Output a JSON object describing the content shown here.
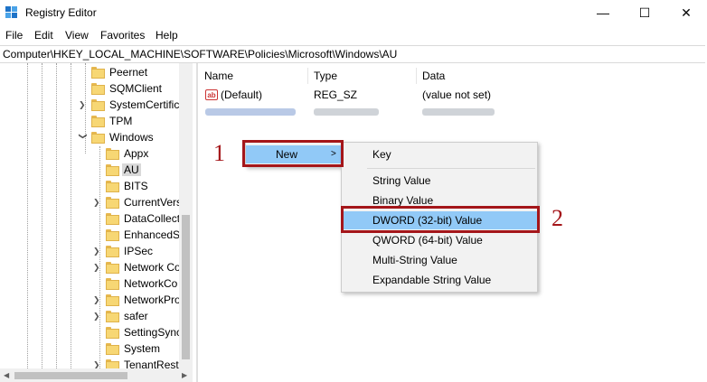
{
  "window": {
    "title": "Registry Editor",
    "icon": "registry-editor-icon",
    "controls": {
      "minimize": "—",
      "maximize": "☐",
      "close": "✕"
    }
  },
  "menu": [
    "File",
    "Edit",
    "View",
    "Favorites",
    "Help"
  ],
  "address": "Computer\\HKEY_LOCAL_MACHINE\\SOFTWARE\\Policies\\Microsoft\\Windows\\AU",
  "tree": {
    "items": [
      {
        "label": "Peernet",
        "level": 1,
        "expander": ""
      },
      {
        "label": "SQMClient",
        "level": 1,
        "expander": ""
      },
      {
        "label": "SystemCertific",
        "level": 1,
        "expander": ">"
      },
      {
        "label": "TPM",
        "level": 1,
        "expander": ""
      },
      {
        "label": "Windows",
        "level": 1,
        "expander": "v"
      },
      {
        "label": "Appx",
        "level": 2,
        "expander": ""
      },
      {
        "label": "AU",
        "level": 2,
        "expander": "",
        "selected": true
      },
      {
        "label": "BITS",
        "level": 2,
        "expander": ""
      },
      {
        "label": "CurrentVers",
        "level": 2,
        "expander": ">"
      },
      {
        "label": "DataCollect",
        "level": 2,
        "expander": ""
      },
      {
        "label": "EnhancedS",
        "level": 2,
        "expander": ""
      },
      {
        "label": "IPSec",
        "level": 2,
        "expander": ">"
      },
      {
        "label": "Network Co",
        "level": 2,
        "expander": ">"
      },
      {
        "label": "NetworkCo",
        "level": 2,
        "expander": ""
      },
      {
        "label": "NetworkPro",
        "level": 2,
        "expander": ">"
      },
      {
        "label": "safer",
        "level": 2,
        "expander": ">"
      },
      {
        "label": "SettingSync",
        "level": 2,
        "expander": ""
      },
      {
        "label": "System",
        "level": 2,
        "expander": ""
      },
      {
        "label": "TenantRestr",
        "level": 2,
        "expander": ">"
      }
    ]
  },
  "list": {
    "headers": {
      "name": "Name",
      "type": "Type",
      "data": "Data"
    },
    "rows": [
      {
        "icon": "string-value-icon",
        "icon_text": "ab",
        "name": "(Default)",
        "type": "REG_SZ",
        "data": "(value not set)"
      }
    ]
  },
  "context_menu": {
    "new_label": "New",
    "new_arrow": ">",
    "submenu": {
      "key": "Key",
      "values": [
        "String Value",
        "Binary Value",
        "DWORD (32-bit) Value",
        "QWORD (64-bit) Value",
        "Multi-String Value",
        "Expandable String Value"
      ],
      "highlighted_index": 2
    }
  },
  "annotations": {
    "step1": "1",
    "step2": "2",
    "color": "#a4161a"
  },
  "colors": {
    "highlight": "#91c9f7",
    "selected_tree": "#d9d9d9",
    "folder": "#f7d774"
  }
}
